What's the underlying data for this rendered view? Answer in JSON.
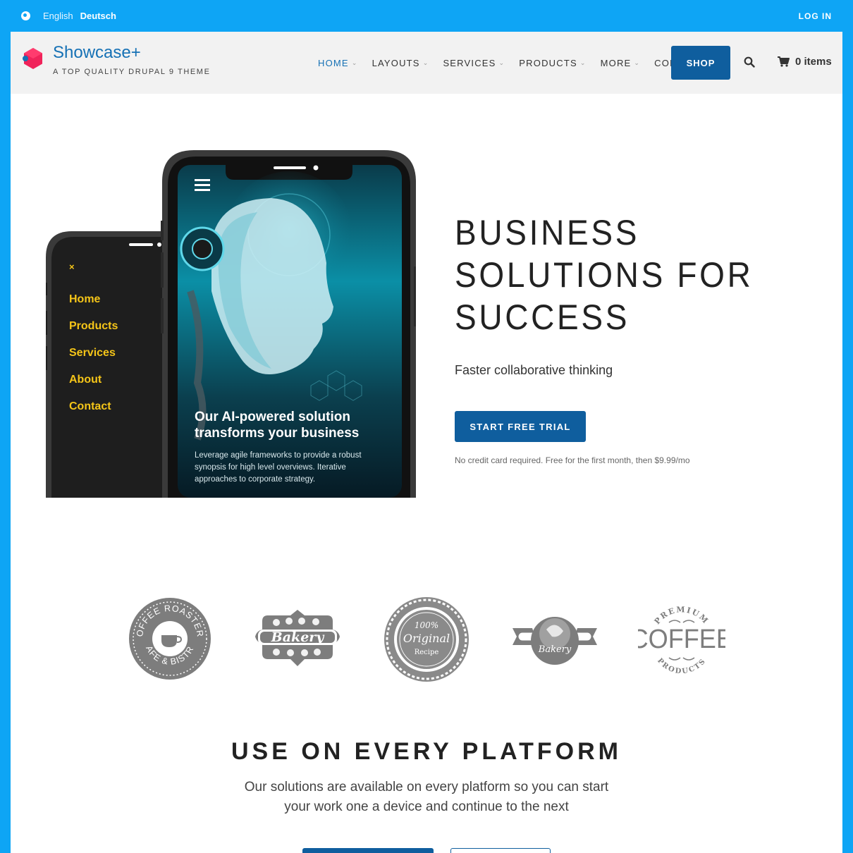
{
  "topbar": {
    "languages": [
      "English",
      "Deutsch"
    ],
    "login": "LOG IN"
  },
  "header": {
    "brand_name": "Showcase+",
    "slogan": "A TOP QUALITY DRUPAL 9 THEME",
    "nav": [
      "HOME",
      "LAYOUTS",
      "SERVICES",
      "PRODUCTS",
      "MORE",
      "CONTACT"
    ],
    "shop": "SHOP",
    "cart": "0 items"
  },
  "hero": {
    "title_line1": "BUSINESS",
    "title_line2": "SOLUTIONS FOR",
    "title_line3": "SUCCESS",
    "subtitle": "Faster collaborative thinking",
    "cta": "START FREE TRIAL",
    "note": "No credit card required. Free for the first month, then $9.99/mo",
    "phone_menu": [
      "Home",
      "Products",
      "Services",
      "About",
      "Contact"
    ],
    "phone_headline1": "Our AI-powered solution",
    "phone_headline2": "transforms your business",
    "phone_text1": "Leverage agile frameworks to provide a robust",
    "phone_text2": "synopsis for high level overviews. Iterative",
    "phone_text3": "approaches to corporate strategy."
  },
  "logos": {
    "coffee_roasters_top": "COFFEE ROASTERS",
    "coffee_roasters_bottom": "CAFE & BISTRO",
    "bakery": "Bakery",
    "original_top": "100%",
    "original_mid": "Original",
    "original_bottom": "Recipe",
    "bakery_ribbon": "Bakery",
    "coffee_premium": "PREMIUM",
    "coffee_main": "COFFEE",
    "coffee_products": "PRODUCTS"
  },
  "platform": {
    "title": "USE ON EVERY PLATFORM",
    "text_line1": "Our solutions are available on every platform so you can start",
    "text_line2": "your work one a device and continue to the next"
  },
  "colors": {
    "frame": "#0ea5f5",
    "brand": "#1671b5",
    "button": "#0f5e9e",
    "phone_menu": "#f5c518"
  }
}
